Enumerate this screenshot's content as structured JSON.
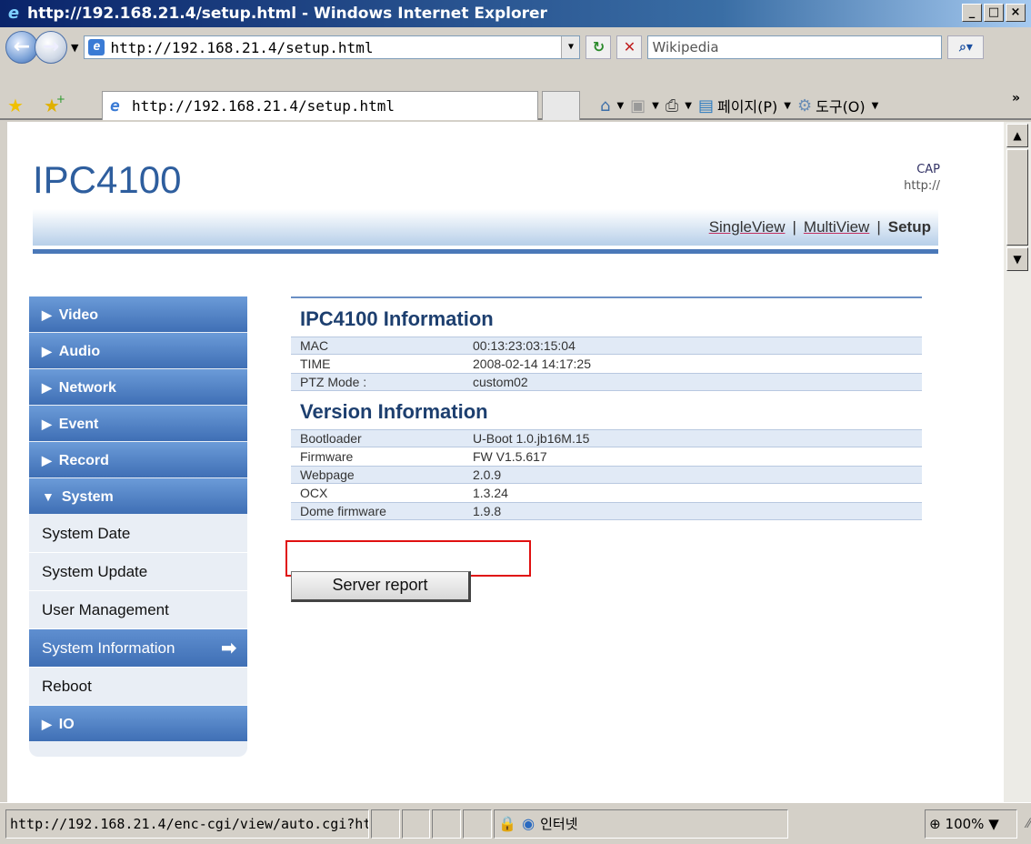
{
  "window": {
    "title": "http://192.168.21.4/setup.html - Windows Internet Explorer"
  },
  "addressbar": {
    "url": "http://192.168.21.4/setup.html",
    "search_placeholder": "Wikipedia"
  },
  "tab": {
    "title": "http://192.168.21.4/setup.html"
  },
  "commandbar": {
    "page_label": "페이지(P)",
    "tools_label": "도구(O)"
  },
  "page": {
    "brand": "IPC4100",
    "cap_line1": "CAP",
    "cap_line2": "http://",
    "toplinks": {
      "single": "SingleView",
      "multi": "MultiView",
      "setup": "Setup",
      "sep": "|"
    },
    "menu": {
      "video": "Video",
      "audio": "Audio",
      "network": "Network",
      "event": "Event",
      "record": "Record",
      "system": "System",
      "system_date": "System Date",
      "system_update": "System Update",
      "user_management": "User Management",
      "system_information": "System Information",
      "reboot": "Reboot",
      "io": "IO"
    },
    "info_title": "IPC4100 Information",
    "info_rows": [
      {
        "k": "MAC",
        "v": "00:13:23:03:15:04"
      },
      {
        "k": "TIME",
        "v": "2008-02-14 14:17:25"
      },
      {
        "k": "PTZ Mode :",
        "v": "custom02"
      }
    ],
    "version_title": "Version Information",
    "version_rows": [
      {
        "k": "Bootloader",
        "v": "U-Boot 1.0.jb16M.15"
      },
      {
        "k": "Firmware",
        "v": "FW V1.5.617"
      },
      {
        "k": "Webpage",
        "v": "2.0.9"
      },
      {
        "k": "OCX",
        "v": "1.3.24"
      },
      {
        "k": "Dome firmware",
        "v": "1.9.8"
      }
    ],
    "server_report": "Server report"
  },
  "statusbar": {
    "url": "http://192.168.21.4/enc-cgi/view/auto.cgi?htm",
    "zone": "인터넷",
    "zoom": "100%"
  },
  "colors": {
    "brand": "#2e5e9e",
    "menu_blue": "#3f6fb5",
    "highlight": "#e01010"
  }
}
